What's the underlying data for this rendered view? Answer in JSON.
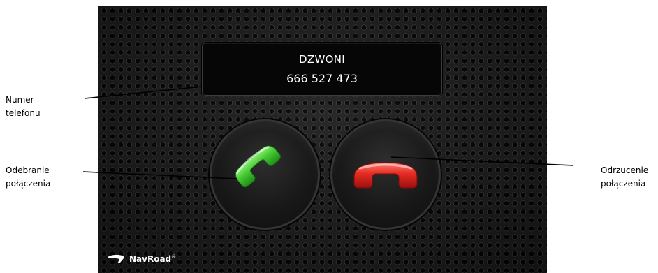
{
  "call": {
    "status": "DZWONI",
    "number": "666 527 473"
  },
  "buttons": {
    "accept_icon": "phone-pickup-icon",
    "decline_icon": "phone-hangup-icon",
    "accept_color": "#3fbf2e",
    "decline_color": "#d81f1f"
  },
  "brand": {
    "name": "NavRoad",
    "mark": "®"
  },
  "callouts": {
    "number": "Numer\ntelefonu",
    "accept": "Odebranie\npołączenia",
    "decline": "Odrzucenie\npołączenia"
  }
}
